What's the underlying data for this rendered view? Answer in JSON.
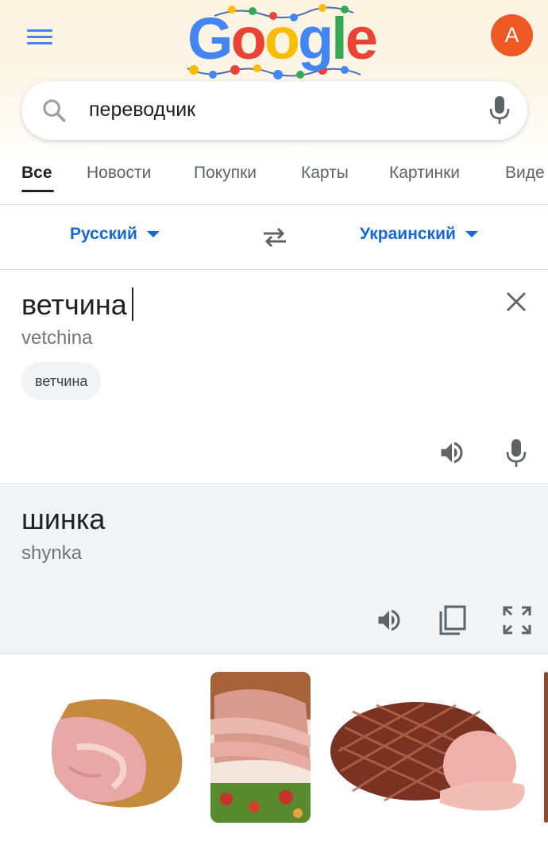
{
  "header": {
    "menu_icon": "hamburger-menu-icon",
    "logo_text": "Google",
    "avatar_letter": "A",
    "avatar_color": "#ef5a24"
  },
  "search": {
    "query": "переводчик",
    "search_icon": "search-icon",
    "mic_icon": "microphone-icon"
  },
  "tabs": [
    {
      "label": "Все",
      "active": true
    },
    {
      "label": "Новости"
    },
    {
      "label": "Покупки"
    },
    {
      "label": "Карты"
    },
    {
      "label": "Картинки"
    },
    {
      "label": "Виде"
    }
  ],
  "translator": {
    "source_lang": "Русский",
    "target_lang": "Украинский",
    "swap_icon": "swap-arrows-icon",
    "source_text": "ветчина",
    "source_translit": "vetchina",
    "suggestion_chip": "ветчина",
    "target_text": "шинка",
    "target_translit": "shynka",
    "accent_color": "#1967d2"
  },
  "images": [
    {
      "alt": "ham-image-1"
    },
    {
      "alt": "ham-image-2"
    },
    {
      "alt": "ham-image-3"
    }
  ]
}
